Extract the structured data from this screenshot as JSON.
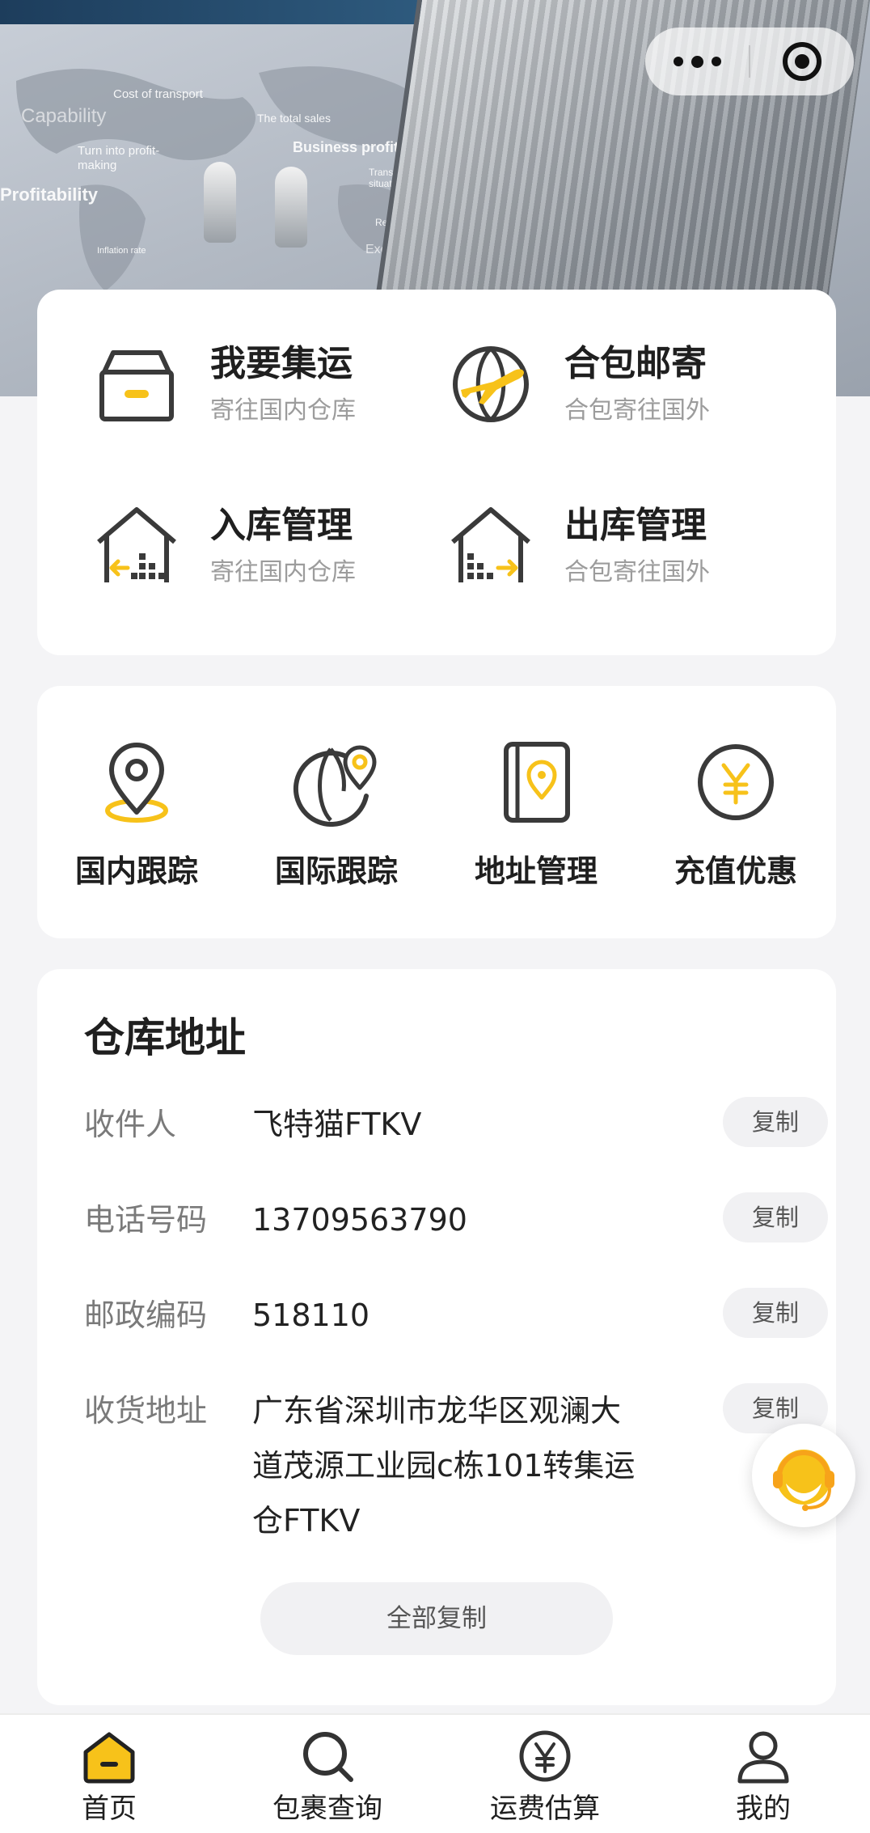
{
  "banner": {
    "words": [
      "Cost of transport",
      "Capability",
      "The total sales",
      "Turn into profit-making",
      "Business profits",
      "Transaction situation",
      "Profitability",
      "Result",
      "Inflation rate",
      "Exchange rate"
    ]
  },
  "capsule": {
    "more_icon": "more-dots-icon",
    "close_icon": "target-close-icon"
  },
  "services": [
    {
      "title": "我要集运",
      "subtitle": "寄往国内仓库",
      "icon": "box-icon"
    },
    {
      "title": "合包邮寄",
      "subtitle": "合包寄往国外",
      "icon": "globe-plane-icon"
    },
    {
      "title": "入库管理",
      "subtitle": "寄往国内仓库",
      "icon": "warehouse-in-icon"
    },
    {
      "title": "出库管理",
      "subtitle": "合包寄往国外",
      "icon": "warehouse-out-icon"
    }
  ],
  "tools": [
    {
      "label": "国内跟踪",
      "icon": "location-pin-icon"
    },
    {
      "label": "国际跟踪",
      "icon": "globe-pin-icon"
    },
    {
      "label": "地址管理",
      "icon": "address-book-icon"
    },
    {
      "label": "充值优惠",
      "icon": "yen-coin-icon"
    }
  ],
  "warehouse": {
    "title": "仓库地址",
    "copy_label": "复制",
    "copy_all_label": "全部复制",
    "rows": [
      {
        "key": "收件人",
        "value": "飞特猫FTKV"
      },
      {
        "key": "电话号码",
        "value": "13709563790"
      },
      {
        "key": "邮政编码",
        "value": "518110"
      },
      {
        "key": "收货地址",
        "value": "广东省深圳市龙华区观澜大道茂源工业园c栋101转集运仓FTKV"
      }
    ]
  },
  "support_icon": "customer-service-icon",
  "tabbar": [
    {
      "label": "首页",
      "icon": "home-icon",
      "active": true
    },
    {
      "label": "包裹查询",
      "icon": "search-icon",
      "active": false
    },
    {
      "label": "运费估算",
      "icon": "yen-icon",
      "active": false
    },
    {
      "label": "我的",
      "icon": "user-icon",
      "active": false
    }
  ],
  "colors": {
    "accent": "#f7c21a",
    "icon_dark": "#3a3a3a",
    "background": "#f4f4f6"
  }
}
